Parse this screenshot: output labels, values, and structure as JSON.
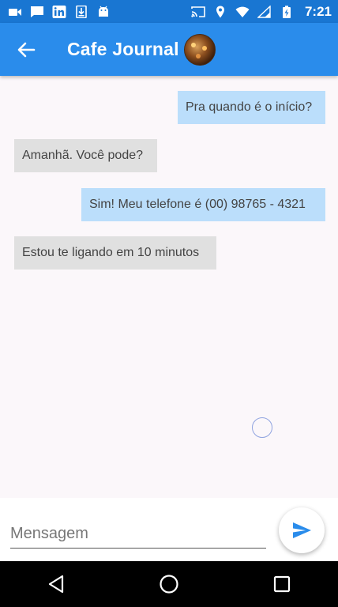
{
  "status_bar": {
    "time": "7:21",
    "left_icons": [
      "video-call-icon",
      "message-icon",
      "linkedin-icon",
      "download-icon",
      "android-icon"
    ],
    "right_icons": [
      "cast-icon",
      "location-icon",
      "wifi-icon",
      "signal-icon",
      "battery-icon"
    ]
  },
  "app_bar": {
    "title": "Cafe Journal",
    "back_icon": "arrow-back-icon",
    "color": "#2a8ceb"
  },
  "messages": [
    {
      "text": "Pra quando é o início?",
      "from": "me"
    },
    {
      "text": "Amanhã. Você pode?",
      "from": "other"
    },
    {
      "text": "Sim! Meu telefone é (00) 98765 -  4321",
      "from": "me"
    },
    {
      "text": "Estou te ligando em 10 minutos",
      "from": "other"
    }
  ],
  "composer": {
    "placeholder": "Mensagem",
    "value": "",
    "send_icon": "send-icon",
    "send_color": "#2a8ceb"
  },
  "nav_bar": {
    "icons": [
      "back-triangle-icon",
      "home-circle-icon",
      "recents-square-icon"
    ]
  },
  "colors": {
    "status_bar": "#1976d2",
    "sent_bubble": "#bbdefb",
    "received_bubble": "#e0e0e0",
    "background": "#fbf7fa"
  }
}
